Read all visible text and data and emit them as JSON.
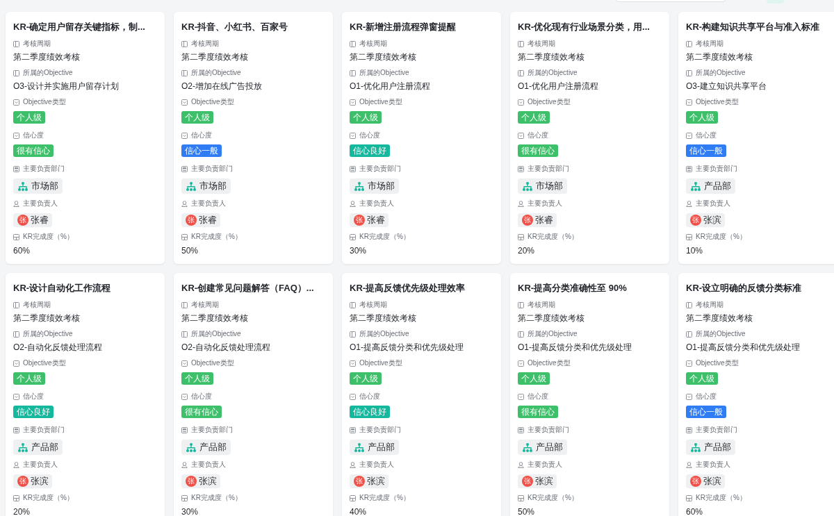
{
  "cards": [
    {
      "title": "KR-确定用户留存关键指标，制...",
      "fields": [
        {
          "kind": "text",
          "label": "考核周期",
          "value": "第二季度绩效考核"
        },
        {
          "kind": "text",
          "label": "所属的Objective",
          "value": "O3-设计并实施用户留存计划"
        },
        {
          "kind": "tag",
          "label": "Objective类型",
          "value": "个人级",
          "color": "#3ec06b"
        },
        {
          "kind": "tag",
          "label": "信心度",
          "value": "很有信心",
          "color": "#3ec06b"
        },
        {
          "kind": "department",
          "label": "主要负责部门",
          "value": "市场部"
        },
        {
          "kind": "person",
          "label": "主要负责人",
          "avatar": "张",
          "value": "张睿"
        },
        {
          "kind": "number",
          "label": "KR完成度（%）",
          "value": "60%"
        }
      ]
    },
    {
      "title": "KR-抖音、小红书、百家号",
      "fields": [
        {
          "kind": "text",
          "label": "考核周期",
          "value": "第二季度绩效考核"
        },
        {
          "kind": "text",
          "label": "所属的Objective",
          "value": "O2-增加在线广告投放"
        },
        {
          "kind": "tag",
          "label": "Objective类型",
          "value": "个人级",
          "color": "#3ec06b"
        },
        {
          "kind": "tag",
          "label": "信心度",
          "value": "信心一般",
          "color": "#2f7cf4"
        },
        {
          "kind": "department",
          "label": "主要负责部门",
          "value": "市场部"
        },
        {
          "kind": "person",
          "label": "主要负责人",
          "avatar": "张",
          "value": "张睿"
        },
        {
          "kind": "number",
          "label": "KR完成度（%）",
          "value": "50%"
        }
      ]
    },
    {
      "title": "KR-新增注册流程弹窗提醒",
      "fields": [
        {
          "kind": "text",
          "label": "考核周期",
          "value": "第二季度绩效考核"
        },
        {
          "kind": "text",
          "label": "所属的Objective",
          "value": "O1-优化用户注册流程"
        },
        {
          "kind": "tag",
          "label": "Objective类型",
          "value": "个人级",
          "color": "#3ec06b"
        },
        {
          "kind": "tag",
          "label": "信心度",
          "value": "信心良好",
          "color": "#14b89c"
        },
        {
          "kind": "department",
          "label": "主要负责部门",
          "value": "市场部"
        },
        {
          "kind": "person",
          "label": "主要负责人",
          "avatar": "张",
          "value": "张睿"
        },
        {
          "kind": "number",
          "label": "KR完成度（%）",
          "value": "30%"
        }
      ]
    },
    {
      "title": "KR-优化现有行业场景分类，用...",
      "fields": [
        {
          "kind": "text",
          "label": "考核周期",
          "value": "第二季度绩效考核"
        },
        {
          "kind": "text",
          "label": "所属的Objective",
          "value": "O1-优化用户注册流程"
        },
        {
          "kind": "tag",
          "label": "Objective类型",
          "value": "个人级",
          "color": "#3ec06b"
        },
        {
          "kind": "tag",
          "label": "信心度",
          "value": "很有信心",
          "color": "#3ec06b"
        },
        {
          "kind": "department",
          "label": "主要负责部门",
          "value": "市场部"
        },
        {
          "kind": "person",
          "label": "主要负责人",
          "avatar": "张",
          "value": "张睿"
        },
        {
          "kind": "number",
          "label": "KR完成度（%）",
          "value": "20%"
        }
      ]
    },
    {
      "title": "KR-构建知识共享平台与准入标准",
      "fields": [
        {
          "kind": "text",
          "label": "考核周期",
          "value": "第二季度绩效考核"
        },
        {
          "kind": "text",
          "label": "所属的Objective",
          "value": "O3-建立知识共享平台"
        },
        {
          "kind": "tag",
          "label": "Objective类型",
          "value": "个人级",
          "color": "#3ec06b"
        },
        {
          "kind": "tag",
          "label": "信心度",
          "value": "信心一般",
          "color": "#2f7cf4"
        },
        {
          "kind": "department",
          "label": "主要负责部门",
          "value": "产品部"
        },
        {
          "kind": "person",
          "label": "主要负责人",
          "avatar": "张",
          "value": "张滨"
        },
        {
          "kind": "number",
          "label": "KR完成度（%）",
          "value": "10%"
        }
      ]
    },
    {
      "title": "KR-设计自动化工作流程",
      "fields": [
        {
          "kind": "text",
          "label": "考核周期",
          "value": "第二季度绩效考核"
        },
        {
          "kind": "text",
          "label": "所属的Objective",
          "value": "O2-自动化反馈处理流程"
        },
        {
          "kind": "tag",
          "label": "Objective类型",
          "value": "个人级",
          "color": "#3ec06b"
        },
        {
          "kind": "tag",
          "label": "信心度",
          "value": "信心良好",
          "color": "#14b89c"
        },
        {
          "kind": "department",
          "label": "主要负责部门",
          "value": "产品部"
        },
        {
          "kind": "person",
          "label": "主要负责人",
          "avatar": "张",
          "value": "张滨"
        },
        {
          "kind": "number",
          "label": "KR完成度（%）",
          "value": "20%"
        }
      ]
    },
    {
      "title": "KR-创建常见问题解答（FAQ）...",
      "fields": [
        {
          "kind": "text",
          "label": "考核周期",
          "value": "第二季度绩效考核"
        },
        {
          "kind": "text",
          "label": "所属的Objective",
          "value": "O2-自动化反馈处理流程"
        },
        {
          "kind": "tag",
          "label": "Objective类型",
          "value": "个人级",
          "color": "#3ec06b"
        },
        {
          "kind": "tag",
          "label": "信心度",
          "value": "很有信心",
          "color": "#3ec06b"
        },
        {
          "kind": "department",
          "label": "主要负责部门",
          "value": "产品部"
        },
        {
          "kind": "person",
          "label": "主要负责人",
          "avatar": "张",
          "value": "张滨"
        },
        {
          "kind": "number",
          "label": "KR完成度（%）",
          "value": "30%"
        }
      ]
    },
    {
      "title": "KR-提高反馈优先级处理效率",
      "fields": [
        {
          "kind": "text",
          "label": "考核周期",
          "value": "第二季度绩效考核"
        },
        {
          "kind": "text",
          "label": "所属的Objective",
          "value": "O1-提高反馈分类和优先级处理"
        },
        {
          "kind": "tag",
          "label": "Objective类型",
          "value": "个人级",
          "color": "#3ec06b"
        },
        {
          "kind": "tag",
          "label": "信心度",
          "value": "信心良好",
          "color": "#14b89c"
        },
        {
          "kind": "department",
          "label": "主要负责部门",
          "value": "产品部"
        },
        {
          "kind": "person",
          "label": "主要负责人",
          "avatar": "张",
          "value": "张滨"
        },
        {
          "kind": "number",
          "label": "KR完成度（%）",
          "value": "40%"
        }
      ]
    },
    {
      "title": "KR-提高分类准确性至 90%",
      "fields": [
        {
          "kind": "text",
          "label": "考核周期",
          "value": "第二季度绩效考核"
        },
        {
          "kind": "text",
          "label": "所属的Objective",
          "value": "O1-提高反馈分类和优先级处理"
        },
        {
          "kind": "tag",
          "label": "Objective类型",
          "value": "个人级",
          "color": "#3ec06b"
        },
        {
          "kind": "tag",
          "label": "信心度",
          "value": "很有信心",
          "color": "#3ec06b"
        },
        {
          "kind": "department",
          "label": "主要负责部门",
          "value": "产品部"
        },
        {
          "kind": "person",
          "label": "主要负责人",
          "avatar": "张",
          "value": "张滨"
        },
        {
          "kind": "number",
          "label": "KR完成度（%）",
          "value": "50%"
        }
      ]
    },
    {
      "title": "KR-设立明确的反馈分类标准",
      "fields": [
        {
          "kind": "text",
          "label": "考核周期",
          "value": "第二季度绩效考核"
        },
        {
          "kind": "text",
          "label": "所属的Objective",
          "value": "O1-提高反馈分类和优先级处理"
        },
        {
          "kind": "tag",
          "label": "Objective类型",
          "value": "个人级",
          "color": "#3ec06b"
        },
        {
          "kind": "tag",
          "label": "信心度",
          "value": "信心一般",
          "color": "#2f7cf4"
        },
        {
          "kind": "department",
          "label": "主要负责部门",
          "value": "产品部"
        },
        {
          "kind": "person",
          "label": "主要负责人",
          "avatar": "张",
          "value": "张滨"
        },
        {
          "kind": "number",
          "label": "KR完成度（%）",
          "value": "60%"
        }
      ]
    }
  ]
}
